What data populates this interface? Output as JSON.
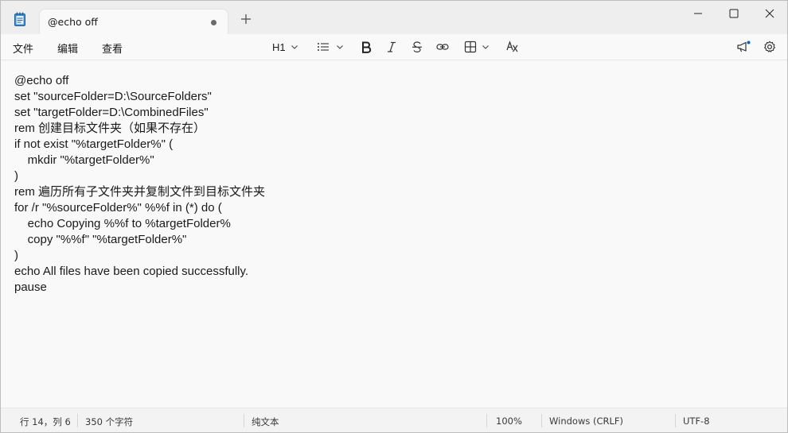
{
  "tab": {
    "title": "@echo off"
  },
  "menu": {
    "file": "文件",
    "edit": "编辑",
    "view": "查看"
  },
  "toolbar": {
    "heading_label": "H1"
  },
  "icons": {
    "app": "notepad-icon",
    "tab_unsaved": "unsaved-dot-icon",
    "new_tab": "plus-icon",
    "minimize": "minimize-icon",
    "maximize": "maximize-icon",
    "close": "close-icon",
    "heading_chevron": "chevron-down-icon",
    "list": "list-icon",
    "bold": "bold-icon",
    "italic": "italic-icon",
    "strikethrough": "strikethrough-icon",
    "link": "link-icon",
    "table": "table-icon",
    "clear_format": "clear-formatting-icon",
    "whats_new": "megaphone-icon",
    "settings": "gear-icon"
  },
  "editor": {
    "lines": [
      "@echo off",
      "set \"sourceFolder=D:\\SourceFolders\"",
      "set \"targetFolder=D:\\CombinedFiles\"",
      "rem 创建目标文件夹（如果不存在）",
      "if not exist \"%targetFolder%\" (",
      "    mkdir \"%targetFolder%\"",
      ")",
      "rem 遍历所有子文件夹并复制文件到目标文件夹",
      "for /r \"%sourceFolder%\" %%f in (*) do (",
      "    echo Copying %%f to %targetFolder%",
      "    copy \"%%f\" \"%targetFolder%\"",
      ")",
      "echo All files have been copied successfully.",
      "pause"
    ]
  },
  "status": {
    "position": "行 14，列 6",
    "char_count": "350 个字符",
    "format": "纯文本",
    "zoom": "100%",
    "line_ending": "Windows (CRLF)",
    "encoding": "UTF-8"
  },
  "colors": {
    "accent": "#0067c0",
    "text": "#1a1a1a",
    "background": "#f9f9f9"
  }
}
